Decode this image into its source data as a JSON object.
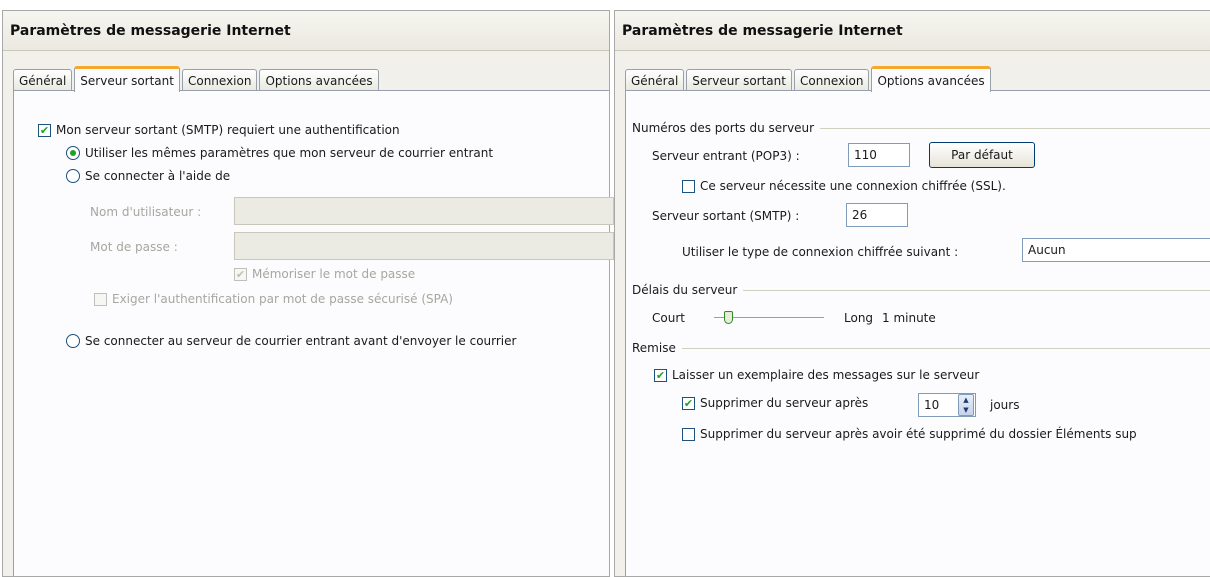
{
  "left_window": {
    "title": "Paramètres de messagerie Internet",
    "tabs": [
      "Général",
      "Serveur sortant",
      "Connexion",
      "Options avancées"
    ],
    "active_tab": "Serveur sortant",
    "auth_required_label": "Mon serveur sortant (SMTP) requiert une authentification",
    "auth_required_checked": true,
    "same_settings_label": "Utiliser les mêmes paramètres que mon serveur de courrier entrant",
    "same_settings_selected": true,
    "login_with_label": "Se connecter à l'aide de",
    "username_label": "Nom d'utilisateur :",
    "username_value": "",
    "password_label": "Mot de passe :",
    "password_value": "",
    "remember_password_label": "Mémoriser le mot de passe",
    "remember_password_checked": true,
    "spa_label": "Exiger l'authentification par mot de passe sécurisé (SPA)",
    "spa_checked": false,
    "pop_before_smtp_label": "Se connecter au serveur de courrier entrant avant d'envoyer le courrier"
  },
  "right_window": {
    "title": "Paramètres de messagerie Internet",
    "tabs": [
      "Général",
      "Serveur sortant",
      "Connexion",
      "Options avancées"
    ],
    "active_tab": "Options avancées",
    "ports_group": "Numéros des ports du serveur",
    "incoming_label": "Serveur entrant (POP3) :",
    "incoming_port": "110",
    "default_button": "Par défaut",
    "ssl_label": "Ce serveur nécessite une connexion chiffrée (SSL).",
    "ssl_checked": false,
    "outgoing_label": "Serveur sortant (SMTP) :",
    "outgoing_port": "26",
    "encryption_label": "Utiliser le type de connexion chiffrée suivant :",
    "encryption_value": "Aucun",
    "timeout_group": "Délais du serveur",
    "timeout_short": "Court",
    "timeout_long": "Long",
    "timeout_value": "1 minute",
    "timeout_slider_fraction": 0.1,
    "delivery_group": "Remise",
    "leave_copy_label": "Laisser un exemplaire des messages sur le serveur",
    "leave_copy_checked": true,
    "remove_after_label": "Supprimer du serveur après",
    "remove_after_checked": true,
    "remove_after_days": "10",
    "days_label": "jours",
    "remove_deleted_label": "Supprimer du serveur après avoir été supprimé du dossier Éléments sup",
    "remove_deleted_checked": false
  },
  "colors": {
    "window_bg": "#f1f0ea",
    "panel_bg": "#fcfcfe",
    "active_tab_accent": "#f5a82c",
    "check_green": "#21a121",
    "control_border": "#1c5180"
  }
}
